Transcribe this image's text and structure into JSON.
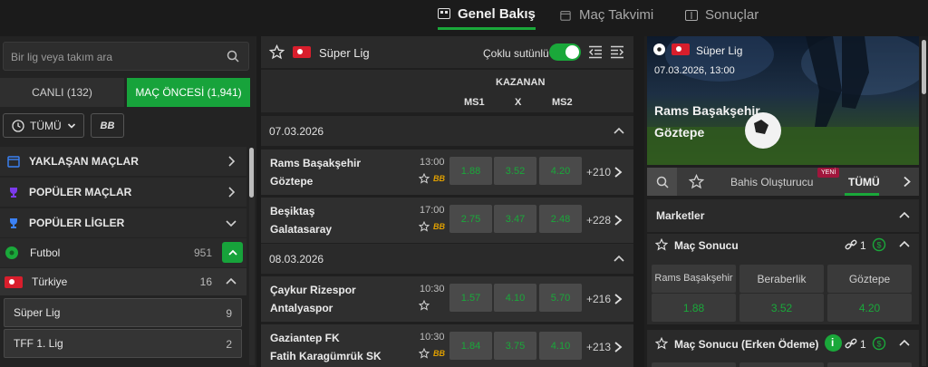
{
  "top_nav": {
    "overview": "Genel Bakış",
    "calendar": "Maç Takvimi",
    "results": "Sonuçlar"
  },
  "left": {
    "search_placeholder": "Bir lig veya takım ara",
    "live_label": "CANLI (132)",
    "pre_label": "MAÇ ÖNCESİ (1,941)",
    "all_label": "TÜMÜ",
    "bb_label": "BB",
    "menu": [
      {
        "label": "YAKLAŞAN MAÇLAR",
        "icon": "calendar-clock-icon"
      },
      {
        "label": "POPÜLER MAÇLAR",
        "icon": "trophy-icon"
      },
      {
        "label": "POPÜLER LİGLER",
        "icon": "trophy-icon"
      }
    ],
    "sport": {
      "label": "Futbol",
      "count": "951"
    },
    "country": {
      "label": "Türkiye",
      "count": "16"
    },
    "leagues": [
      {
        "label": "Süper Lig",
        "count": "9"
      },
      {
        "label": "TFF 1. Lig",
        "count": "2"
      }
    ]
  },
  "middle": {
    "league_title": "Süper Lig",
    "multi_column_label": "Çoklu sutünlü",
    "group_label": "KAZANAN",
    "col_ms1": "MS1",
    "col_x": "X",
    "col_ms2": "MS2",
    "dates": [
      "07.03.2026",
      "08.03.2026"
    ],
    "matches": [
      {
        "home": "Rams Başakşehir",
        "away": "Göztepe",
        "time": "13:00",
        "ms1": "1.88",
        "x": "3.52",
        "ms2": "4.20",
        "more": "+210"
      },
      {
        "home": "Beşiktaş",
        "away": "Galatasaray",
        "time": "17:00",
        "ms1": "2.75",
        "x": "3.47",
        "ms2": "2.48",
        "more": "+228"
      },
      {
        "home": "Çaykur Rizespor",
        "away": "Antalyaspor",
        "time": "10:30",
        "ms1": "1.57",
        "x": "4.10",
        "ms2": "5.70",
        "more": "+216"
      },
      {
        "home": "Gaziantep FK",
        "away": "Fatih Karagümrük SK",
        "time": "10:30",
        "ms1": "1.84",
        "x": "3.75",
        "ms2": "4.10",
        "more": "+213"
      }
    ]
  },
  "right": {
    "league": "Süper Lig",
    "datetime": "07.03.2026, 13:00",
    "home": "Rams Başakşehir",
    "away": "Göztepe",
    "bet_builder_label": "Bahis Oluşturucu",
    "new_badge": "YENİ",
    "all_tab": "TÜMÜ",
    "markets_label": "Marketler",
    "market1": {
      "title": "Maç Sonucu",
      "link_count": "1",
      "selections": [
        {
          "label": "Rams Başakşehir",
          "odd": "1.88"
        },
        {
          "label": "Beraberlik",
          "odd": "3.52"
        },
        {
          "label": "Göztepe",
          "odd": "4.20"
        }
      ]
    },
    "market2": {
      "title": "Maç Sonucu (Erken Ödeme)",
      "link_count": "1"
    }
  },
  "colors": {
    "accent": "#17a33b",
    "odd_text": "#1aa83a",
    "background": "#1b1b1b"
  }
}
